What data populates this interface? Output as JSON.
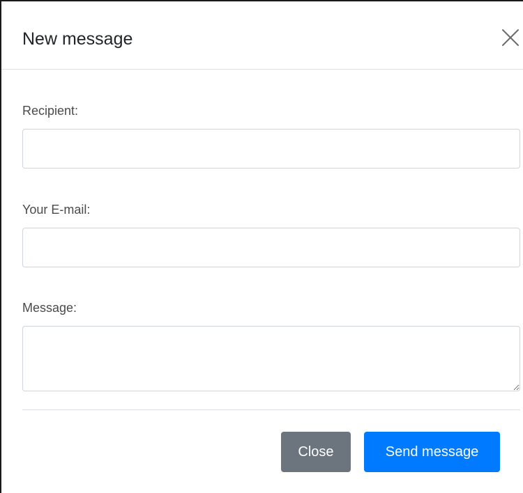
{
  "modal": {
    "title": "New message",
    "close_icon": "close-x-icon"
  },
  "form": {
    "recipient": {
      "label": "Recipient:",
      "value": "",
      "placeholder": ""
    },
    "email": {
      "label": "Your E-mail:",
      "value": "",
      "placeholder": ""
    },
    "message": {
      "label": "Message:",
      "value": "",
      "placeholder": ""
    }
  },
  "footer": {
    "close_label": "Close",
    "send_label": "Send message"
  },
  "colors": {
    "primary": "#007bff",
    "secondary": "#6c757d",
    "border": "#ced4da",
    "divider": "#dee2e6"
  }
}
